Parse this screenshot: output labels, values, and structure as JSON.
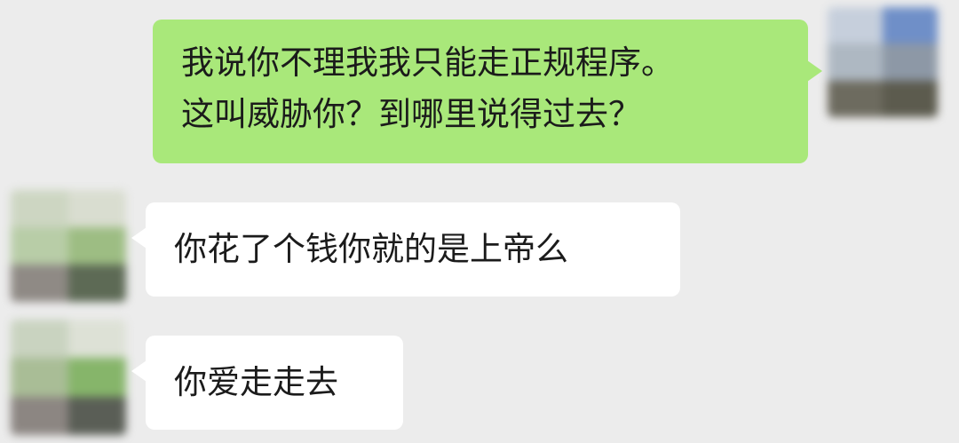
{
  "messages": [
    {
      "side": "right",
      "lines": [
        "我说你不理我我只能走正规程序。",
        "这叫威胁你？到哪里说得过去？"
      ],
      "bubble_color": "#a9e87a"
    },
    {
      "side": "left",
      "lines": [
        "你花了个钱你就的是上帝么"
      ],
      "bubble_color": "#ffffff"
    },
    {
      "side": "left",
      "lines": [
        "你爱走走去"
      ],
      "bubble_color": "#ffffff"
    }
  ],
  "avatars": {
    "right": [
      "#c6cfdc",
      "#6f8fc8",
      "#aeb8c2",
      "#8d98a6",
      "#6d6b5f",
      "#5c5b4e"
    ],
    "left_1": [
      "#cdd6c2",
      "#d9ddd0",
      "#b8cda7",
      "#9dbd83",
      "#8f8a85",
      "#5d6a55"
    ],
    "left_2": [
      "#c9d3c0",
      "#dde1d6",
      "#a9bd96",
      "#86b56a",
      "#8c8682",
      "#5a5e56"
    ]
  },
  "colors": {
    "background": "#ececec",
    "outgoing": "#a9e87a",
    "incoming": "#ffffff",
    "text": "#1b1b1b"
  }
}
